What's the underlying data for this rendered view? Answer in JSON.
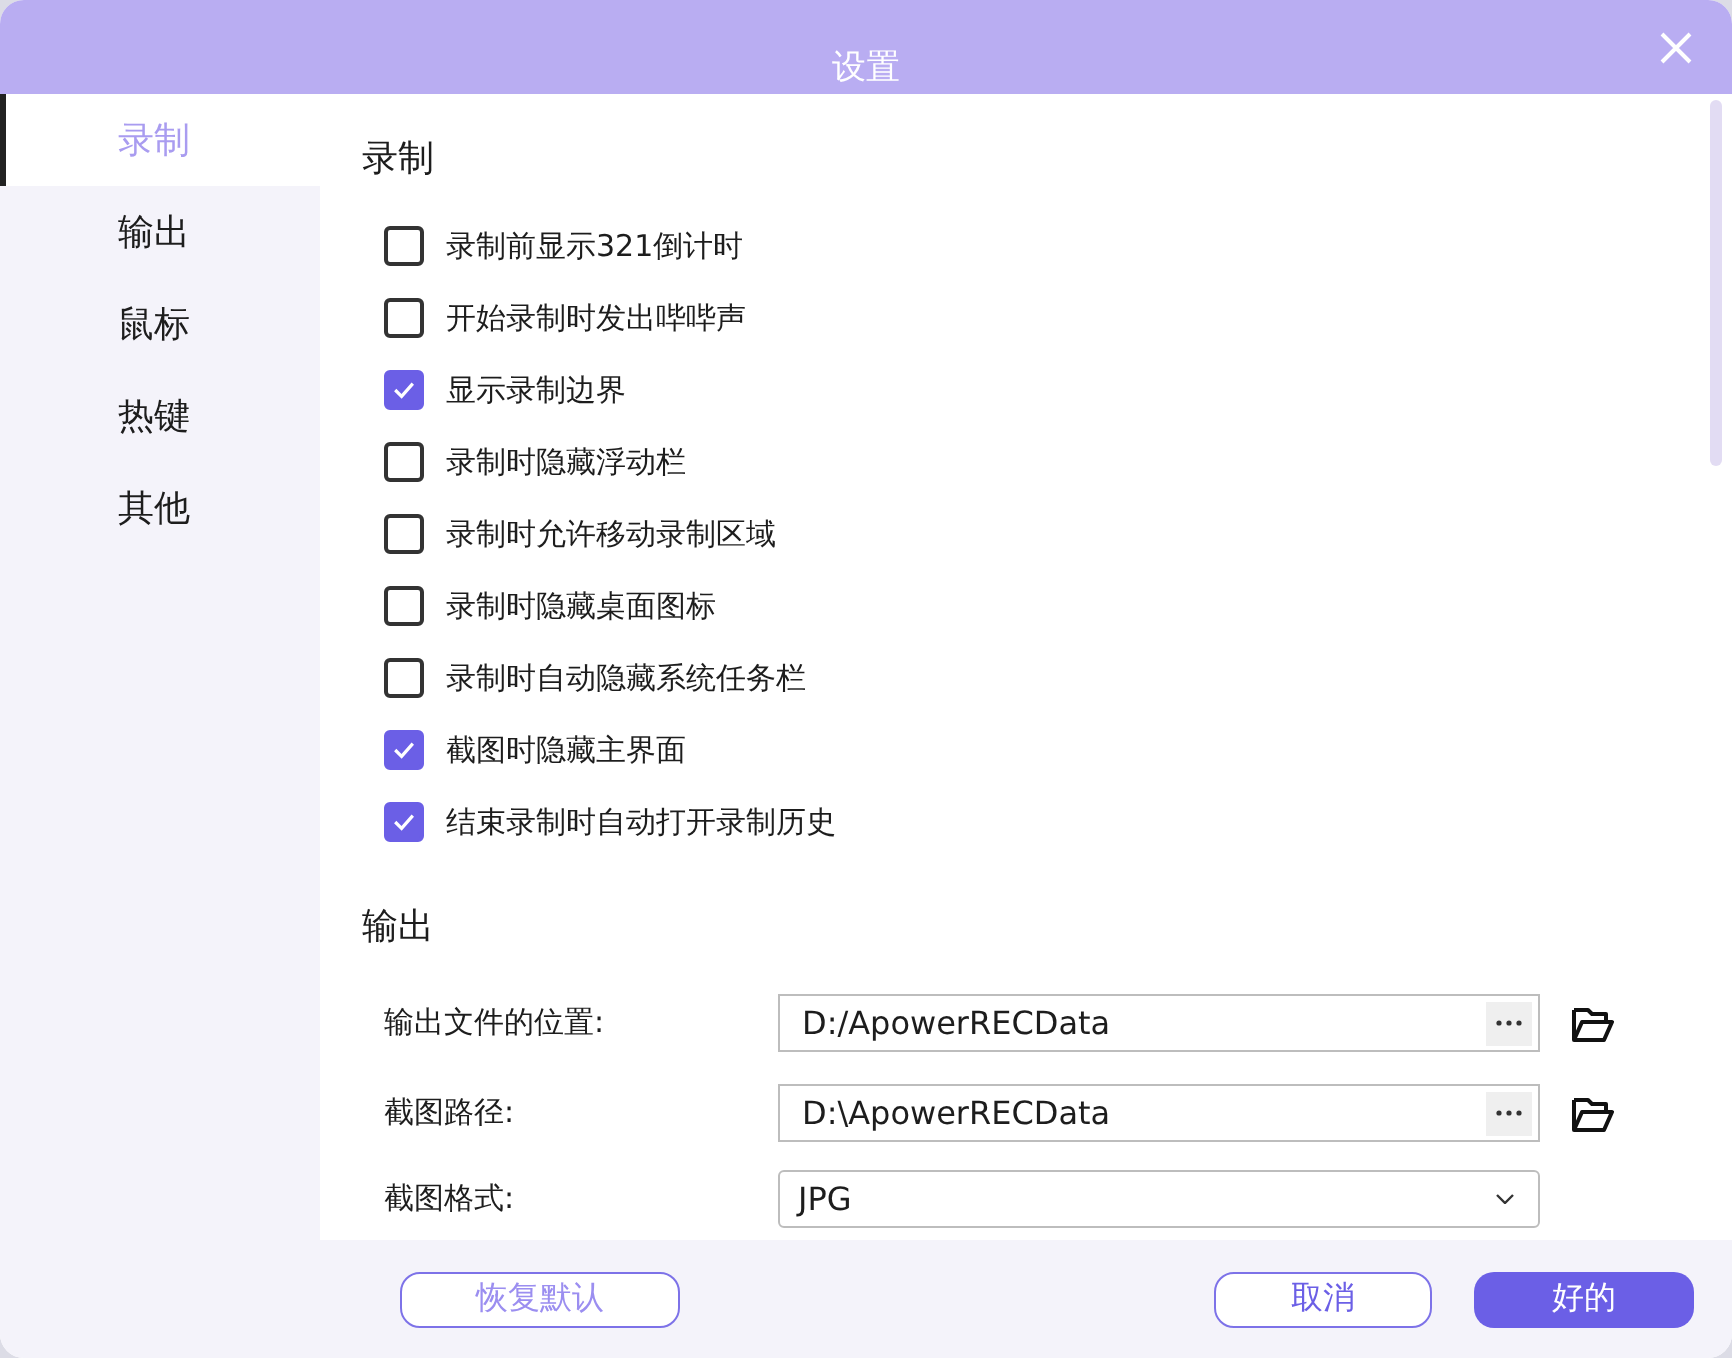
{
  "window": {
    "title": "设置"
  },
  "sidebar": {
    "items": [
      {
        "label": "录制",
        "selected": true
      },
      {
        "label": "输出",
        "selected": false
      },
      {
        "label": "鼠标",
        "selected": false
      },
      {
        "label": "热键",
        "selected": false
      },
      {
        "label": "其他",
        "selected": false
      }
    ]
  },
  "recording": {
    "heading": "录制",
    "options": [
      {
        "label": "录制前显示321倒计时",
        "checked": false
      },
      {
        "label": "开始录制时发出哔哔声",
        "checked": false
      },
      {
        "label": "显示录制边界",
        "checked": true
      },
      {
        "label": "录制时隐藏浮动栏",
        "checked": false
      },
      {
        "label": "录制时允许移动录制区域",
        "checked": false
      },
      {
        "label": "录制时隐藏桌面图标",
        "checked": false
      },
      {
        "label": "录制时自动隐藏系统任务栏",
        "checked": false
      },
      {
        "label": "截图时隐藏主界面",
        "checked": true
      },
      {
        "label": "结束录制时自动打开录制历史",
        "checked": true
      }
    ]
  },
  "output": {
    "heading": "输出",
    "fields": [
      {
        "kind": "path",
        "label": "输出文件的位置:",
        "value": "D:/ApowerRECData"
      },
      {
        "kind": "path",
        "label": "截图路径:",
        "value": "D:\\ApowerRECData"
      },
      {
        "kind": "dropdown",
        "label": "截图格式:",
        "value": "JPG"
      }
    ]
  },
  "footer": {
    "reset_button": "恢复默认",
    "buttons": [
      {
        "label": "取消",
        "kind": "outline"
      },
      {
        "label": "好的",
        "kind": "primary"
      }
    ]
  }
}
